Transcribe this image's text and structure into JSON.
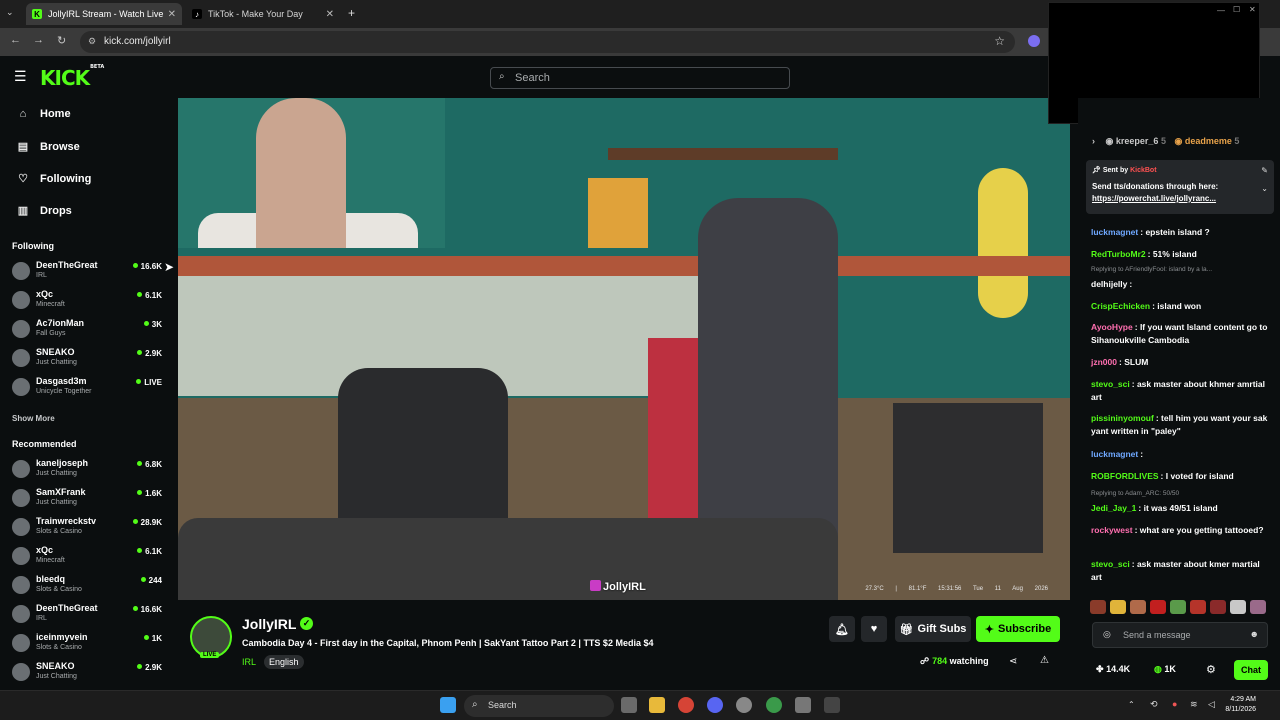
{
  "browser": {
    "tabs": [
      {
        "label": "JollyIRL Stream - Watch Live",
        "active": true
      },
      {
        "label": "TikTok - Make Your Day",
        "active": false
      }
    ],
    "url": "kick.com/jollyirl"
  },
  "site": {
    "logo": "KICK",
    "logo_badge": "BETA",
    "search_placeholder": "Search",
    "accent": "#53fc18"
  },
  "sidebar": {
    "nav": [
      {
        "label": "Home",
        "icon": "home-icon"
      },
      {
        "label": "Browse",
        "icon": "browse-icon"
      },
      {
        "label": "Following",
        "icon": "heart-icon"
      },
      {
        "label": "Drops",
        "icon": "drops-icon"
      }
    ],
    "following_title": "Following",
    "following": [
      {
        "name": "DeenTheGreat",
        "category": "IRL",
        "viewers": "16.6K"
      },
      {
        "name": "xQc",
        "category": "Minecraft",
        "viewers": "6.1K"
      },
      {
        "name": "Ac7ionMan",
        "category": "Fall Guys",
        "viewers": "3K"
      },
      {
        "name": "SNEAKO",
        "category": "Just Chatting",
        "viewers": "2.9K"
      },
      {
        "name": "Dasgasd3m",
        "category": "Unicycle Together",
        "viewers": "LIVE"
      }
    ],
    "show_more": "Show More",
    "recommended_title": "Recommended",
    "recommended": [
      {
        "name": "kaneljoseph",
        "category": "Just Chatting",
        "viewers": "6.8K"
      },
      {
        "name": "SamXFrank",
        "category": "Just Chatting",
        "viewers": "1.6K"
      },
      {
        "name": "Trainwreckstv",
        "category": "Slots & Casino",
        "viewers": "28.9K"
      },
      {
        "name": "xQc",
        "category": "Minecraft",
        "viewers": "6.1K"
      },
      {
        "name": "bleedq",
        "category": "Slots & Casino",
        "viewers": "244"
      },
      {
        "name": "DeenTheGreat",
        "category": "IRL",
        "viewers": "16.6K"
      },
      {
        "name": "iceinmyvein",
        "category": "Slots & Casino",
        "viewers": "1K"
      },
      {
        "name": "SNEAKO",
        "category": "Just Chatting",
        "viewers": "2.9K"
      }
    ]
  },
  "video": {
    "watermark": "JollyIRL",
    "overlay_temp": "27.3°C | 81.1°F",
    "overlay_time": "15:31:56",
    "overlay_date": "Tue 11 Aug 2026"
  },
  "stream": {
    "name": "JollyIRL",
    "live_badge": "LIVE",
    "title": "Cambodia Day 4 - First day in the Capital, Phnom Penh | SakYant Tattoo Part 2 | TTS $2 Media $4",
    "category": "IRL",
    "language": "English",
    "gift_label": "Gift Subs",
    "subscribe_label": "Subscribe",
    "viewers": "784",
    "watching_label": "watching"
  },
  "chat": {
    "top_gifters": [
      {
        "name": "kreeper_6",
        "count": "5"
      },
      {
        "name": "deadmeme",
        "count": "5"
      }
    ],
    "pinned": {
      "sent_by_label": "Sent by",
      "sender": "KickBot",
      "message": "Send tts/donations through here:",
      "link": "https://powerchat.live/jollyranc..."
    },
    "messages": [
      {
        "user": "luckmagnet",
        "color": "#6fa8ff",
        "text": "epstein island ?"
      },
      {
        "user": "RedTurboMr2",
        "color": "#53fc18",
        "text": "51% island"
      },
      {
        "reply": "Replying to AFriendlyFool: island by a la..."
      },
      {
        "user": "delhijelly",
        "color": "#ffffff",
        "text": ""
      },
      {
        "user": "CrispEchicken",
        "color": "#53fc18",
        "text": "island won"
      },
      {
        "user": "AyooHype",
        "color": "#ff6fb0",
        "text": "If you want Island content go to Sihanoukville Cambodia"
      },
      {
        "user": "jzn000",
        "color": "#ff6fb0",
        "text": "SLUM"
      },
      {
        "user": "stevo_sci",
        "color": "#53fc18",
        "text": "ask master about khmer amrtial art"
      },
      {
        "user": "pissininyomouf",
        "color": "#53fc18",
        "text": "tell him you want your sak yant written in \"paley\""
      },
      {
        "user": "luckmagnet",
        "color": "#6fa8ff",
        "text": ""
      },
      {
        "user": "ROBFORDLIVES",
        "color": "#53fc18",
        "text": "I voted for island"
      },
      {
        "reply": "Replying to Adam_ARC: 50/50"
      },
      {
        "user": "Jedi_Jay_1",
        "color": "#53fc18",
        "text": "it was 49/51 island"
      },
      {
        "user": "rockywest",
        "color": "#ff6fb0",
        "text": "what are you getting tattooed?"
      },
      {
        "user": "stevo_sci",
        "color": "#53fc18",
        "text": "ask master about kmer martial art"
      }
    ],
    "input_placeholder": "Send a message",
    "kicks": "14.4K",
    "points": "1K",
    "chat_button": "Chat"
  },
  "taskbar": {
    "search_placeholder": "Search",
    "time": "4:29 AM",
    "date": "8/11/2026"
  }
}
